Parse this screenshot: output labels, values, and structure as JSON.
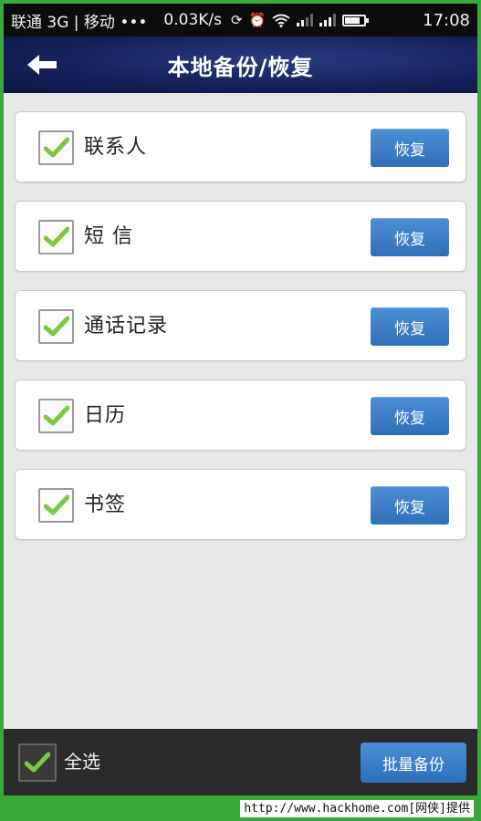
{
  "status_bar": {
    "carrier": "联通 3G | 移动 •••",
    "speed": "0.03K/s",
    "time": "17:08"
  },
  "header": {
    "title": "本地备份/恢复"
  },
  "items": [
    {
      "label": "联系人",
      "checked": true,
      "action": "恢复"
    },
    {
      "label": "短 信",
      "checked": true,
      "action": "恢复"
    },
    {
      "label": "通话记录",
      "checked": true,
      "action": "恢复"
    },
    {
      "label": "日历",
      "checked": true,
      "action": "恢复"
    },
    {
      "label": "书签",
      "checked": true,
      "action": "恢复"
    }
  ],
  "footer_bar": {
    "select_all_label": "全选",
    "select_all_checked": true,
    "batch_backup_label": "批量备份"
  },
  "watermark": {
    "text": "http://www.hackhome.com[网侠]提供"
  },
  "colors": {
    "accent_blue": "#2e6fb9",
    "check_green": "#7ac943",
    "header_navy": "#14205a",
    "frame_green": "#3aa83a"
  }
}
